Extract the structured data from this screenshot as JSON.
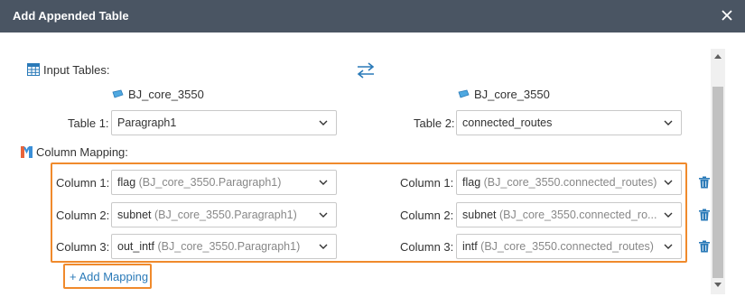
{
  "dialog": {
    "title": "Add Appended Table"
  },
  "input_tables": {
    "label": "Input Tables:",
    "left_source": "BJ_core_3550",
    "right_source": "BJ_core_3550",
    "table1_label": "Table 1:",
    "table1_value": "Paragraph1",
    "table2_label": "Table 2:",
    "table2_value": "connected_routes"
  },
  "column_mapping": {
    "label": "Column Mapping:",
    "rows": [
      {
        "left_label": "Column 1:",
        "left_name": "flag",
        "left_src": "(BJ_core_3550.Paragraph1)",
        "right_label": "Column 1:",
        "right_name": "flag",
        "right_src": "(BJ_core_3550.connected_routes)"
      },
      {
        "left_label": "Column 2:",
        "left_name": "subnet",
        "left_src": "(BJ_core_3550.Paragraph1)",
        "right_label": "Column 2:",
        "right_name": "subnet",
        "right_src": "(BJ_core_3550.connected_ro..."
      },
      {
        "left_label": "Column 3:",
        "left_name": "out_intf",
        "left_src": "(BJ_core_3550.Paragraph1)",
        "right_label": "Column 3:",
        "right_name": "intf",
        "right_src": "(BJ_core_3550.connected_routes)"
      }
    ],
    "add_label": "+ Add Mapping"
  },
  "colors": {
    "titlebar": "#4a5563",
    "highlight": "#f08a2c",
    "link": "#2a7ab8",
    "icon_blue": "#2a7ab8"
  },
  "icons": {
    "close": "close-icon",
    "table": "table-icon",
    "swap": "swap-icon",
    "db": "database-icon",
    "mapping": "mapping-icon",
    "trash": "trash-icon",
    "chevron": "chevron-down-icon"
  }
}
